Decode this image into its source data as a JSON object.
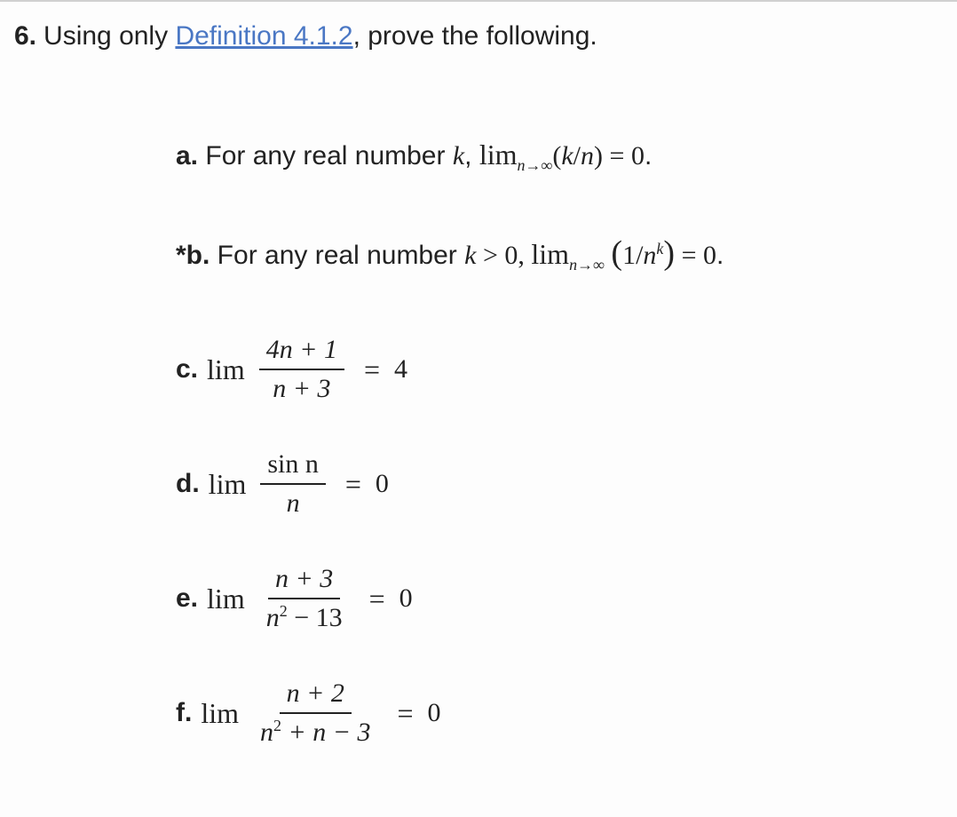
{
  "problem": {
    "number": "6.",
    "stem_prefix": "Using only ",
    "link_text": "Definition 4.1.2",
    "stem_suffix": ", prove the following."
  },
  "items": {
    "a": {
      "label": "a.",
      "text_prefix": " For any real number ",
      "var_k": "k",
      "after_k": ", ",
      "lim_word": "lim",
      "lim_sub": "n→∞",
      "paren_open": "(",
      "paren_close": ")",
      "kn_numer": "k",
      "kn_slash": "/",
      "kn_denom": "n",
      "eq": " = ",
      "rhs": "0",
      "period": "."
    },
    "b": {
      "label": "*b.",
      "text_prefix": " For any real number ",
      "var_k": "k",
      "gt0": " > 0, ",
      "lim_word": "lim",
      "lim_sub": "n→∞",
      "space": " ",
      "paren_open": "(",
      "one_over": "1/",
      "n": "n",
      "exp_k": "k",
      "paren_close": ")",
      "eq": " = ",
      "rhs": "0",
      "period": "."
    },
    "c": {
      "label": "c.",
      "lim_word": "lim",
      "numerator": "4n + 1",
      "denominator": "n + 3",
      "eq": "=",
      "rhs": "4"
    },
    "d": {
      "label": "d.",
      "lim_word": "lim",
      "numerator": "sin n",
      "denominator": "n",
      "eq": "=",
      "rhs": "0"
    },
    "e": {
      "label": "e.",
      "lim_word": "lim",
      "numerator": "n + 3",
      "denom_a": "n",
      "denom_exp": "2",
      "denom_b": " − 13",
      "eq": "=",
      "rhs": "0"
    },
    "f": {
      "label": "f.",
      "lim_word": "lim",
      "numerator": "n + 2",
      "denom_a": "n",
      "denom_exp": "2",
      "denom_b": " + n − 3",
      "eq": "=",
      "rhs": "0"
    }
  }
}
